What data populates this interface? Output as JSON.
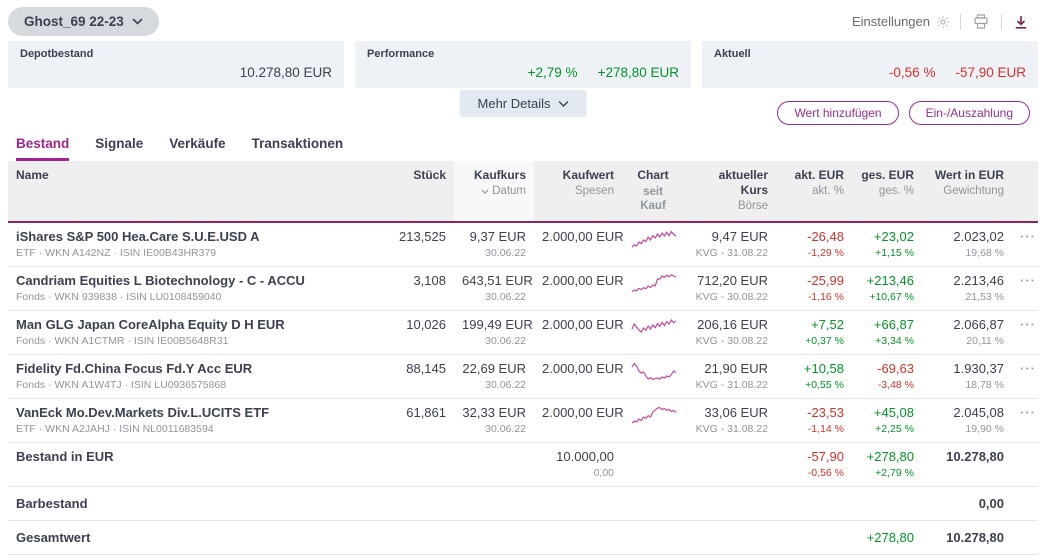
{
  "colors": {
    "accent": "#962d8f",
    "tab_accent": "#a1258c",
    "positive": "#009626",
    "negative": "#d4322b",
    "sparkline": "#c2489c",
    "header_rule": "#8d2462"
  },
  "icons": {
    "portfolio_chevron": "chevron-down",
    "settings": "gear",
    "print": "printer",
    "download": "download-arrow",
    "sort": "chevron-down",
    "row_menu": "···"
  },
  "topbar": {
    "portfolio_selector": "Ghost_69 22-23",
    "settings_label": "Einstellungen"
  },
  "summary": {
    "depot": {
      "label": "Depotbestand",
      "value": "10.278,80 EUR"
    },
    "performance": {
      "label": "Performance",
      "percent": "+2,79 %",
      "value": "+278,80 EUR"
    },
    "aktuell": {
      "label": "Aktuell",
      "percent": "-0,56 %",
      "value": "-57,90 EUR"
    },
    "more_details": "Mehr Details"
  },
  "actions": {
    "add": "Wert hinzufügen",
    "cash": "Ein-/Auszahlung"
  },
  "tabs": {
    "items": [
      {
        "label": "Bestand"
      },
      {
        "label": "Signale"
      },
      {
        "label": "Verkäufe"
      },
      {
        "label": "Transaktionen"
      }
    ],
    "active": "Bestand"
  },
  "table": {
    "headers": {
      "name": "Name",
      "stueck": "Stück",
      "kaufkurs": "Kaufkurs",
      "kaufkurs_sub": "Datum",
      "kaufwert": "Kaufwert",
      "kaufwert_sub": "Spesen",
      "chart": "Chart",
      "chart_sub": "seit Kauf",
      "kurs": "aktueller Kurs",
      "kurs_sub": "Börse",
      "akt": "akt. EUR",
      "akt_sub": "akt. %",
      "ges": "ges. EUR",
      "ges_sub": "ges. %",
      "wert": "Wert in EUR",
      "wert_sub": "Gewichtung"
    },
    "rows": [
      {
        "name": "iShares S&P 500 Hea.Care S.U.E.USD A",
        "meta": "ETF · WKN A142NZ · ISIN IE00B43HR379",
        "stueck": "213,525",
        "kaufkurs": "9,37 EUR",
        "datum": "30.06.22",
        "kaufwert": "2.000,00 EUR",
        "kurs": "9,47 EUR",
        "boerse": "KVG - 31.08.22",
        "akt": "-26,48",
        "akt_pct": "-1,29 %",
        "ges": "+23,02",
        "ges_pct": "+1,15 %",
        "wert": "2.023,02",
        "gewichtung": "19,68 %",
        "spark": [
          85,
          75,
          80,
          60,
          68,
          50,
          58,
          35,
          50,
          28,
          40,
          20,
          35,
          15,
          30,
          12,
          28,
          8,
          22,
          30
        ]
      },
      {
        "name": "Candriam Equities L Biotechnology - C - ACCU",
        "meta": "Fonds · WKN 939838 · ISIN LU0108459040",
        "stueck": "3,108",
        "kaufkurs": "643,51 EUR",
        "datum": "30.06.22",
        "kaufwert": "2.000,00 EUR",
        "kurs": "712,20 EUR",
        "boerse": "KVG - 30.08.22",
        "akt": "-25,99",
        "akt_pct": "-1,16 %",
        "ges": "+213,46",
        "ges_pct": "+10,67 %",
        "wert": "2.213,46",
        "gewichtung": "21,53 %",
        "spark": [
          88,
          80,
          84,
          72,
          78,
          68,
          74,
          60,
          68,
          55,
          60,
          25,
          25,
          10,
          18,
          6,
          14,
          4,
          10,
          16
        ]
      },
      {
        "name": "Man GLG Japan CoreAlpha Equity D H EUR",
        "meta": "Fonds · WKN A1CTMR · ISIN IE00B5648R31",
        "stueck": "10,026",
        "kaufkurs": "199,49 EUR",
        "datum": "30.06.22",
        "kaufwert": "2.000,00 EUR",
        "kurs": "206,16 EUR",
        "boerse": "KVG - 30.08.22",
        "akt": "+7,52",
        "akt_pct": "+0,37 %",
        "ges": "+66,87",
        "ges_pct": "+3,34 %",
        "wert": "2.066,87",
        "gewichtung": "20,11 %",
        "spark": [
          55,
          30,
          45,
          60,
          70,
          50,
          62,
          40,
          55,
          35,
          48,
          28,
          42,
          22,
          38,
          18,
          30,
          10,
          24,
          14
        ]
      },
      {
        "name": "Fidelity Fd.China Focus Fd.Y Acc EUR",
        "meta": "Fonds · WKN A1W4TJ · ISIN LU0936575868",
        "stueck": "88,145",
        "kaufkurs": "22,69 EUR",
        "datum": "30.06.22",
        "kaufwert": "2.000,00 EUR",
        "kurs": "21,90 EUR",
        "boerse": "KVG - 31.08.22",
        "akt": "+10,58",
        "akt_pct": "+0,55 %",
        "ges": "-69,63",
        "ges_pct": "-3,48 %",
        "wert": "1.930,37",
        "gewichtung": "18,78 %",
        "spark": [
          25,
          8,
          20,
          45,
          55,
          50,
          70,
          85,
          78,
          88,
          82,
          80,
          85,
          75,
          80,
          70,
          75,
          62,
          45,
          52
        ]
      },
      {
        "name": "VanEck Mo.Dev.Markets Div.L.UCITS ETF",
        "meta": "ETF · WKN A2JAHJ · ISIN NL0011683594",
        "stueck": "61,861",
        "kaufkurs": "32,33 EUR",
        "datum": "30.06.22",
        "kaufwert": "2.000,00 EUR",
        "kurs": "33,06 EUR",
        "boerse": "KVG - 31.08.22",
        "akt": "-23,53",
        "akt_pct": "-1,14 %",
        "ges": "+45,08",
        "ges_pct": "+2,25 %",
        "wert": "2.045,08",
        "gewichtung": "19,90 %",
        "spark": [
          85,
          75,
          80,
          65,
          72,
          55,
          62,
          48,
          55,
          30,
          20,
          10,
          8,
          18,
          12,
          22,
          16,
          28,
          22,
          32
        ]
      }
    ],
    "totals": {
      "bestand": {
        "label": "Bestand in EUR",
        "kaufwert": "10.000,00",
        "spesen": "0,00",
        "akt": "-57,90",
        "akt_pct": "-0,56 %",
        "ges": "+278,80",
        "ges_pct": "+2,79 %",
        "wert": "10.278,80"
      },
      "barbestand": {
        "label": "Barbestand",
        "wert": "0,00"
      },
      "gesamt": {
        "label": "Gesamtwert",
        "ges": "+278,80",
        "wert": "10.278,80"
      }
    }
  }
}
